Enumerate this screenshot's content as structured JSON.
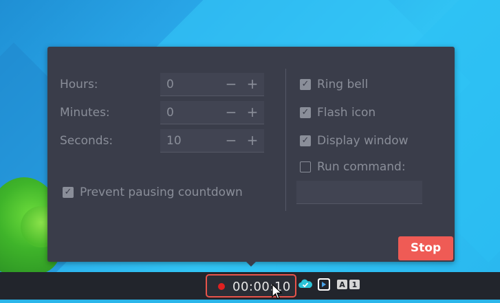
{
  "timer_settings": {
    "hours": {
      "label": "Hours:",
      "value": "0",
      "minus": "−",
      "plus": "+"
    },
    "minutes": {
      "label": "Minutes:",
      "value": "0",
      "minus": "−",
      "plus": "+"
    },
    "seconds": {
      "label": "Seconds:",
      "value": "10",
      "minus": "−",
      "plus": "+"
    },
    "prevent_pausing": {
      "label": "Prevent pausing countdown",
      "checked": true
    }
  },
  "alarm_options": {
    "ring_bell": {
      "label": "Ring bell",
      "checked": true
    },
    "flash_icon": {
      "label": "Flash icon",
      "checked": true
    },
    "display_window": {
      "label": "Display window",
      "checked": true
    },
    "run_command": {
      "label": "Run command:",
      "checked": false
    },
    "command_value": ""
  },
  "stop_label": "Stop",
  "taskbar": {
    "timer_text": "00:00:10",
    "tray_icons": [
      "cloud-check-icon",
      "dropbox-icon",
      "keyboard-layout-icon"
    ],
    "keyboard_layout_text": "A 1"
  },
  "colors": {
    "panel_bg": "#3a3d4a",
    "accent_stop": "#ef5b55",
    "record_dot": "#e02020",
    "timer_border": "#e9544a"
  }
}
